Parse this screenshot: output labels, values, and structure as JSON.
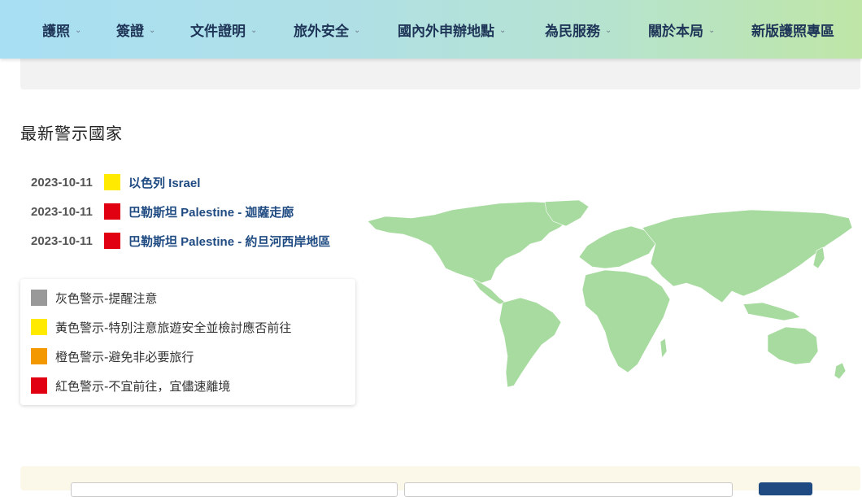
{
  "nav": {
    "items": [
      {
        "label": "護照",
        "dropdown": true
      },
      {
        "label": "簽證",
        "dropdown": true
      },
      {
        "label": "文件證明",
        "dropdown": true
      },
      {
        "label": "旅外安全",
        "dropdown": true
      },
      {
        "label": "國內外申辦地點",
        "dropdown": true
      },
      {
        "label": "為民服務",
        "dropdown": true
      },
      {
        "label": "關於本局",
        "dropdown": true
      },
      {
        "label": "新版護照專區",
        "dropdown": false
      }
    ],
    "chevron_icon": "chevron-down-icon"
  },
  "section_title": "最新警示國家",
  "alerts": [
    {
      "date": "2023-10-11",
      "level_color": "#ffea00",
      "name": "以色列 Israel"
    },
    {
      "date": "2023-10-11",
      "level_color": "#e00012",
      "name": "巴勒斯坦 Palestine - 迦薩走廊"
    },
    {
      "date": "2023-10-11",
      "level_color": "#e00012",
      "name": "巴勒斯坦 Palestine - 約旦河西岸地區"
    }
  ],
  "legend": [
    {
      "color": "#999999",
      "label": "灰色警示-提醒注意"
    },
    {
      "color": "#ffea00",
      "label": "黃色警示-特別注意旅遊安全並檢討應否前往"
    },
    {
      "color": "#f39800",
      "label": "橙色警示-避免非必要旅行"
    },
    {
      "color": "#e00012",
      "label": "紅色警示-不宜前往，宜儘速離境"
    }
  ],
  "colors": {
    "nav_text": "#1f3558",
    "link": "#1f4b82",
    "map_land": "#a8dba0",
    "map_border": "#ffffff"
  }
}
